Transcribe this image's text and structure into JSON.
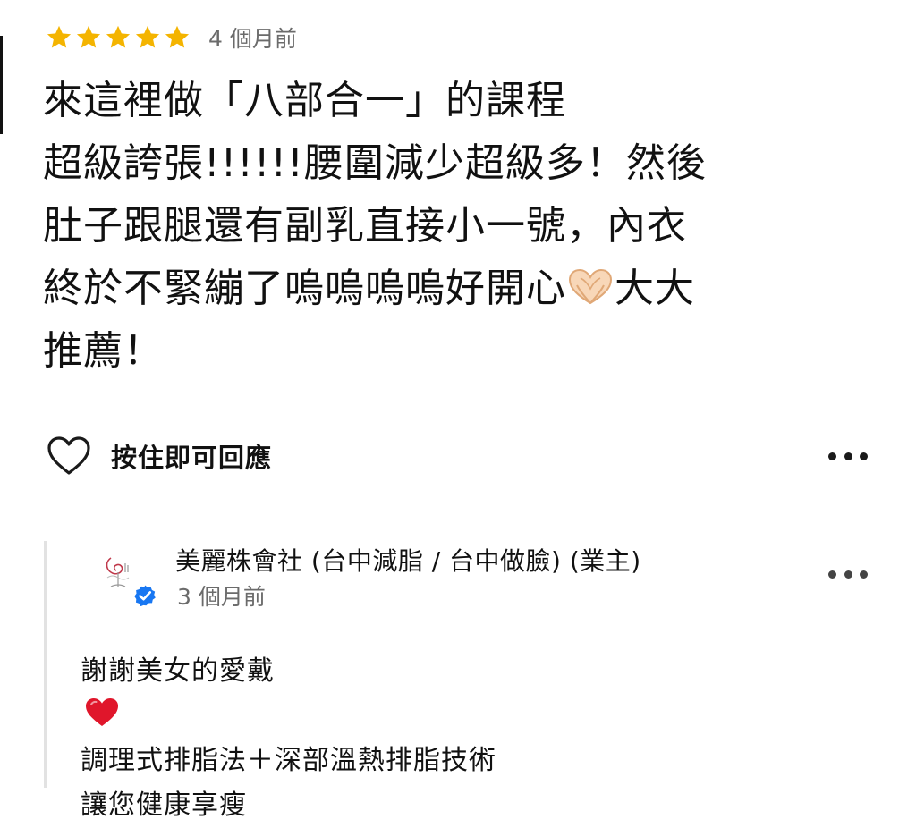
{
  "review": {
    "rating": 5,
    "rating_max": 5,
    "time_ago": "4 個月前",
    "lines": [
      "來這裡做「八部合一」的課程",
      "超級誇張!!!!!!腰圍減少超級多！然後",
      "肚子跟腿還有副乳直接小一號，內衣",
      "終於不緊繃了嗚嗚嗚嗚好開心",
      "推薦！"
    ],
    "line4_suffix": "大大",
    "star_color": "#F4B400",
    "emoji": "heart-hands-emoji"
  },
  "actions": {
    "hold_to_react_label": "按住即可回應",
    "like_icon": "heart-outline-icon",
    "more_icon": "more-options-icon"
  },
  "owner_reply": {
    "name": "美麗株會社 (台中減脂 / 台中做臉) (業主)",
    "time_ago": "3 個月前",
    "verified": true,
    "verified_color": "#1877F2",
    "lines": [
      "謝謝美女的愛戴",
      "調理式排脂法＋深部溫熱排脂技術",
      "讓您健康享瘦"
    ],
    "emoji": "red-heart-emoji"
  }
}
